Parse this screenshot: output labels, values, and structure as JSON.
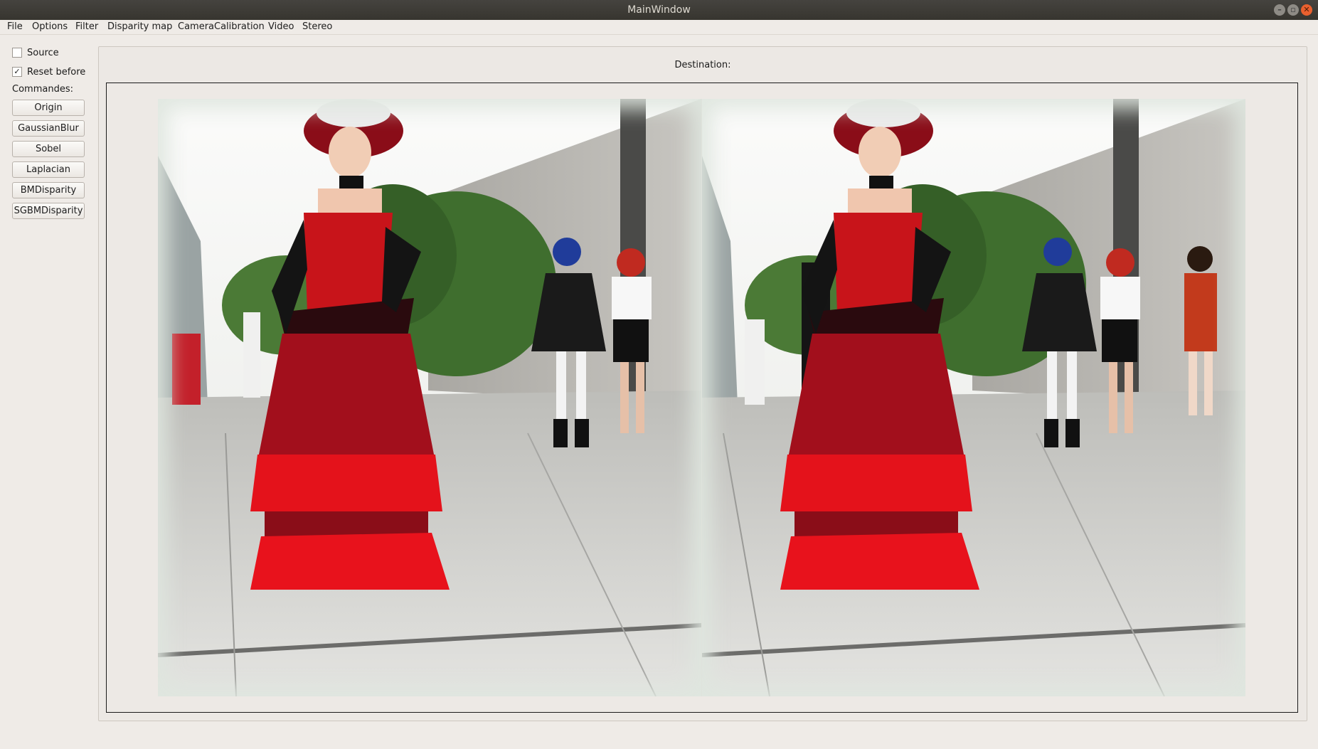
{
  "window": {
    "title": "MainWindow",
    "controls": {
      "minimize": "–",
      "maximize": "▫",
      "close": "✕"
    }
  },
  "menu": {
    "items": [
      "File",
      "Options",
      "Filter",
      "Disparity map",
      "CameraCalibration",
      "Video",
      "Stereo"
    ]
  },
  "left_panel": {
    "source_label": "Source",
    "source_checked": false,
    "reset_label": "Reset before",
    "reset_checked": true,
    "reset_mark": "✓",
    "commandes_label": "Commandes:",
    "buttons": [
      "Origin",
      "GaussianBlur",
      "Sobel",
      "Laplacian",
      "BMDisparity",
      "SGBMDisparity"
    ]
  },
  "destination": {
    "label": "Destination:"
  },
  "colors": {
    "dress_red": "#c8141a",
    "dark_red": "#8a0d18",
    "floor": "#c9c9c6",
    "sky": "#f4f5f3",
    "foliage": "#3c6b2c"
  }
}
